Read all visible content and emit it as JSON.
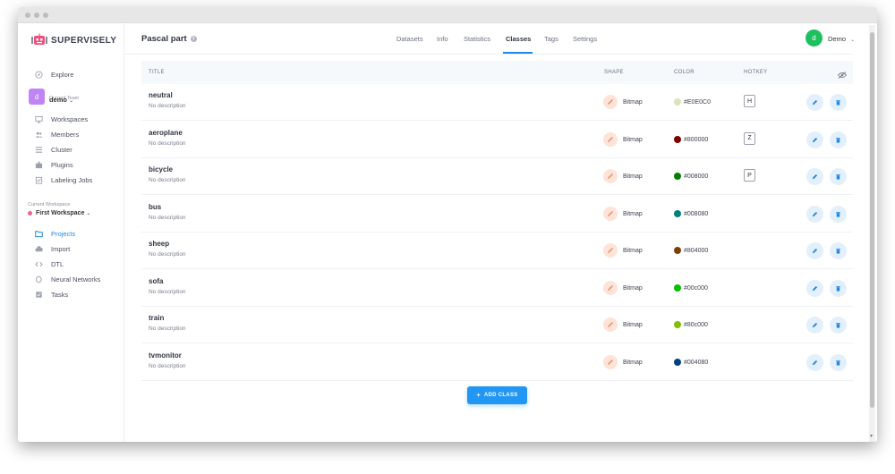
{
  "window": {
    "controls": [
      "close",
      "minimize",
      "maximize"
    ]
  },
  "sidebar": {
    "brand": "SUPERVISELY",
    "explore_label": "Explore",
    "team_label": "Current Team",
    "team_name": "demo",
    "team_avatar": "d",
    "team_items": [
      {
        "label": "Workspaces",
        "icon": "monitor-icon"
      },
      {
        "label": "Members",
        "icon": "members-icon"
      },
      {
        "label": "Cluster",
        "icon": "cluster-icon"
      },
      {
        "label": "Plugins",
        "icon": "puzzle-icon"
      },
      {
        "label": "Labeling Jobs",
        "icon": "clipboard-icon"
      }
    ],
    "workspace_label": "Current Workspace",
    "workspace_name": "First Workspace",
    "workspace_items": [
      {
        "label": "Projects",
        "icon": "folder-icon",
        "active": true
      },
      {
        "label": "Import",
        "icon": "cloud-icon"
      },
      {
        "label": "DTL",
        "icon": "code-icon"
      },
      {
        "label": "Neural Networks",
        "icon": "brain-icon"
      },
      {
        "label": "Tasks",
        "icon": "tasks-icon"
      }
    ]
  },
  "header": {
    "project_title": "Pascal part",
    "tabs": [
      "Datasets",
      "Info",
      "Statistics",
      "Classes",
      "Tags",
      "Settings"
    ],
    "active_tab": "Classes",
    "user_avatar": "d",
    "user_name": "Demo"
  },
  "table": {
    "columns": {
      "title": "TITLE",
      "shape": "SHAPE",
      "color": "COLOR",
      "hotkey": "HOTKEY"
    },
    "rows": [
      {
        "title": "neutral",
        "description": "No description",
        "shape": "Bitmap",
        "color": "#E0E0C0",
        "hotkey": "H"
      },
      {
        "title": "aeroplane",
        "description": "No description",
        "shape": "Bitmap",
        "color": "#800000",
        "hotkey": "Z"
      },
      {
        "title": "bicycle",
        "description": "No description",
        "shape": "Bitmap",
        "color": "#008000",
        "hotkey": "P"
      },
      {
        "title": "bus",
        "description": "No description",
        "shape": "Bitmap",
        "color": "#008080",
        "hotkey": ""
      },
      {
        "title": "sheep",
        "description": "No description",
        "shape": "Bitmap",
        "color": "#804000",
        "hotkey": ""
      },
      {
        "title": "sofa",
        "description": "No description",
        "shape": "Bitmap",
        "color": "#00c000",
        "hotkey": ""
      },
      {
        "title": "train",
        "description": "No description",
        "shape": "Bitmap",
        "color": "#80c000",
        "hotkey": ""
      },
      {
        "title": "tvmonitor",
        "description": "No description",
        "shape": "Bitmap",
        "color": "#004080",
        "hotkey": ""
      }
    ]
  },
  "add_button": "ADD CLASS",
  "colors": {
    "accent": "#1e88e5",
    "avatar_user": "#1fbf5f",
    "avatar_team": "#c085f5"
  }
}
